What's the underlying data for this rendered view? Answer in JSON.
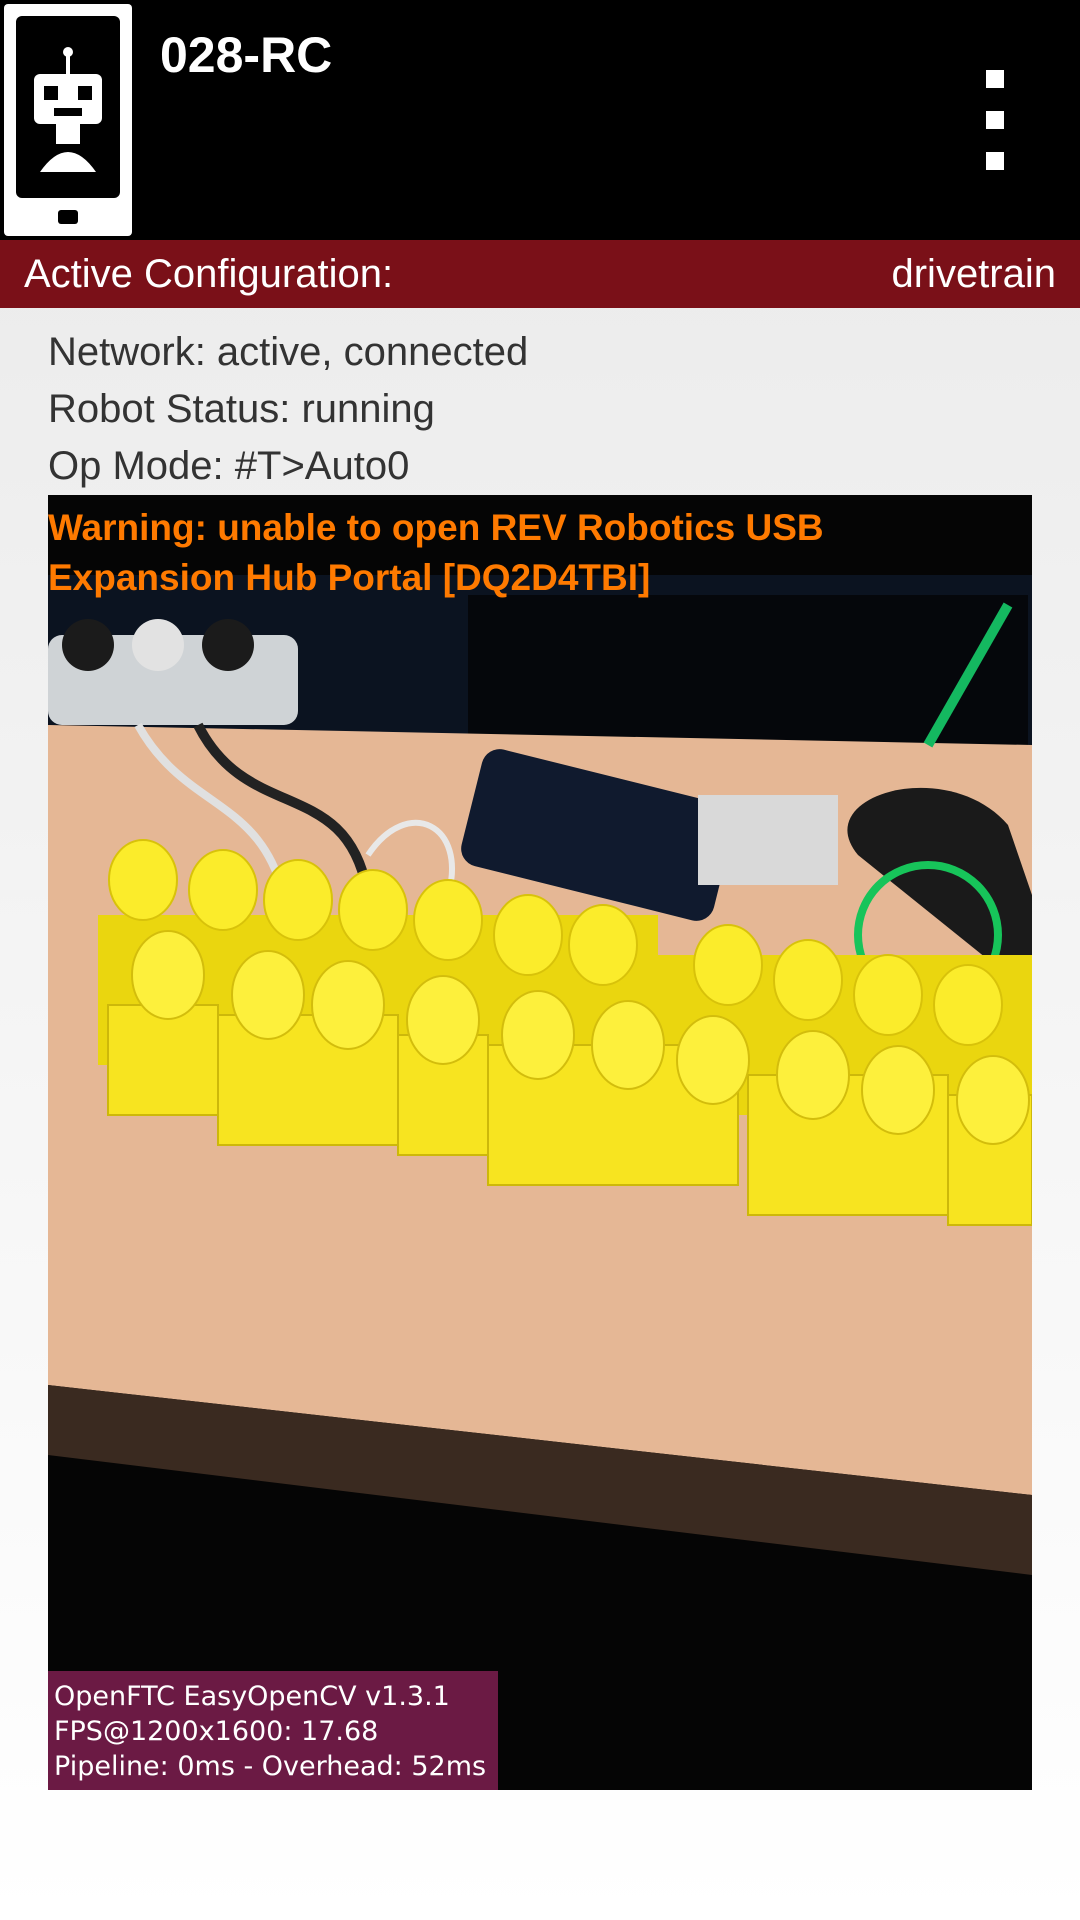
{
  "appbar": {
    "title": "028-RC",
    "app_icon": "robot-phone-icon",
    "menu_icon": "more-vert-icon"
  },
  "config": {
    "label": "Active Configuration:",
    "value": "drivetrain",
    "color": "#7a1018"
  },
  "status": {
    "network": "Network: active, connected",
    "robot": "Robot Status: running",
    "op_mode": "Op Mode: #T>Auto0"
  },
  "camera": {
    "warning": "Warning: unable to open REV Robotics USB Expansion Hub Portal [DQ2D4TBI]",
    "warning_color": "#ff7a00",
    "stats": {
      "line1": "OpenFTC EasyOpenCV v1.3.1",
      "line2": "FPS@1200x1600: 17.68",
      "line3": "Pipeline: 0ms - Overhead: 52ms",
      "background": "#6b1a44"
    }
  }
}
